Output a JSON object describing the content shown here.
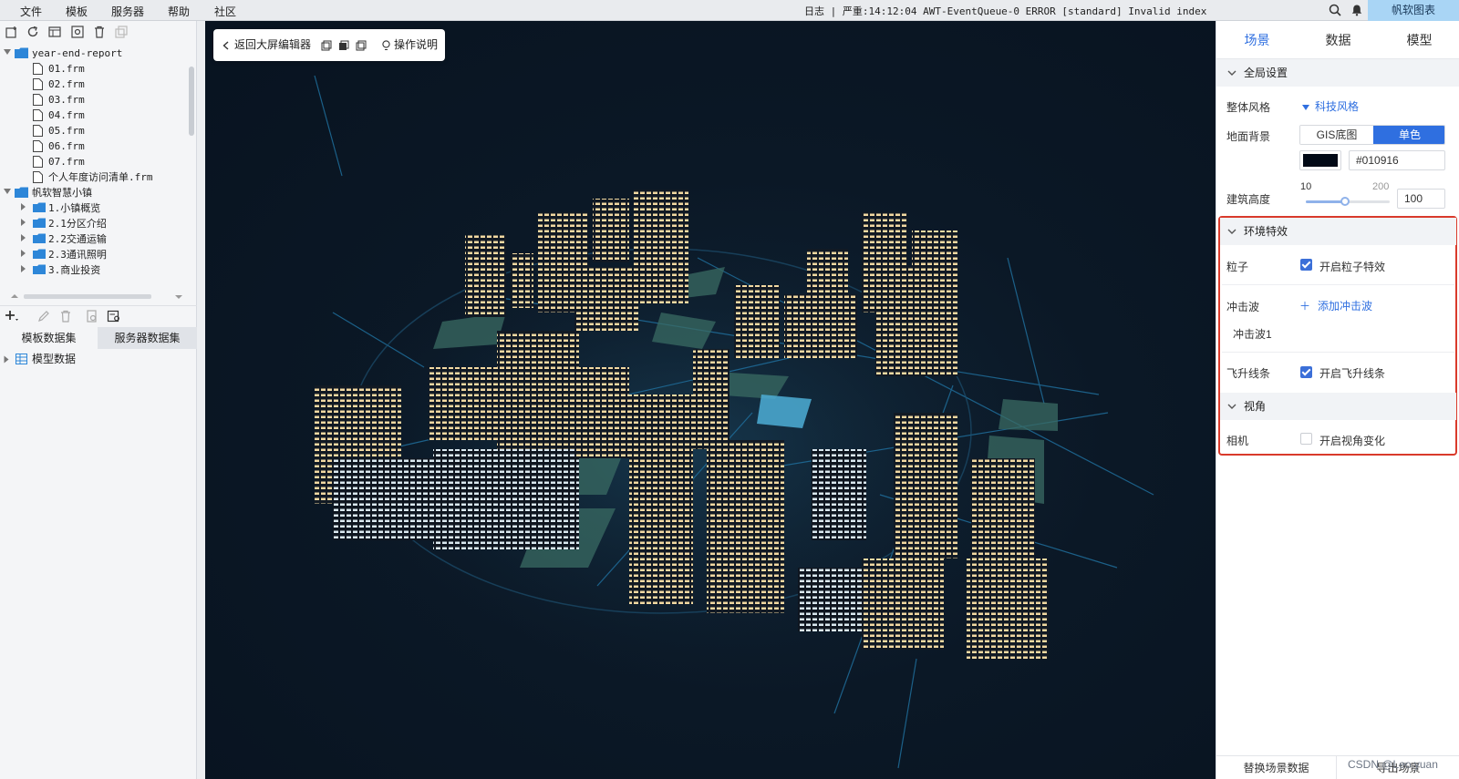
{
  "menubar": {
    "items": [
      "文件",
      "模板",
      "服务器",
      "帮助",
      "社区"
    ],
    "log": "日志 | 严重:14:12:04 AWT-EventQueue-0 ERROR [standard] Invalid index",
    "brand": "帆软图表"
  },
  "tree": {
    "root1": "year-end-report",
    "files": [
      "01.frm",
      "02.frm",
      "03.frm",
      "04.frm",
      "05.frm",
      "06.frm",
      "07.frm",
      "个人年度访问清单.frm"
    ],
    "root2": "帆软智慧小镇",
    "folders": [
      "1.小镇概览",
      "2.1分区介绍",
      "2.2交通运输",
      "2.3通讯照明",
      "3.商业投资"
    ]
  },
  "datasets": {
    "tab_template": "模板数据集",
    "tab_server": "服务器数据集",
    "model_data": "模型数据"
  },
  "viewport": {
    "back": "返回大屏编辑器",
    "help": "操作说明"
  },
  "rightpanel": {
    "tabs": [
      "场景",
      "数据",
      "模型"
    ],
    "global": {
      "title": "全局设置",
      "style_label": "整体风格",
      "style_value": "科技风格",
      "ground_label": "地面背景",
      "ground_options": [
        "GIS底图",
        "单色"
      ],
      "color_value": "#010916",
      "height_label": "建筑高度",
      "height_min": "10",
      "height_max": "200",
      "height_value": "100",
      "height_fraction": 0.47
    },
    "effects": {
      "title": "环境特效",
      "particle_label": "粒子",
      "particle_check": "开启粒子特效",
      "wave_label": "冲击波",
      "wave_add": "添加冲击波",
      "wave_item": "冲击波1",
      "flyline_label": "飞升线条",
      "flyline_check": "开启飞升线条"
    },
    "view": {
      "title": "视角",
      "camera_label": "相机",
      "camera_check": "开启视角变化"
    },
    "bottom": {
      "replace": "替换场景数据",
      "export": "导出场景"
    }
  },
  "watermark": "CSDN @Leo.yuan",
  "colors": {
    "accent": "#2f6fe0",
    "highlight": "#d93a2b",
    "viewport_bg": "#0b1826",
    "window_light": "#f2d9a2"
  }
}
